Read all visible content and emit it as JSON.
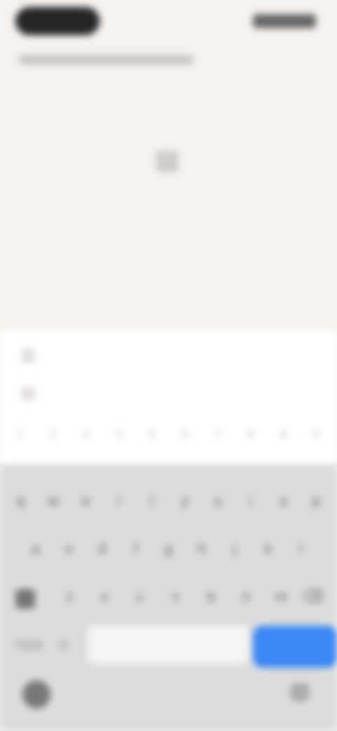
{
  "main": {
    "icon": "document-icon",
    "headline": "",
    "subline": ""
  },
  "suggestions": [
    {
      "text": ""
    },
    {
      "text": ""
    }
  ],
  "keyboard": {
    "number_row": [
      "1",
      "2",
      "3",
      "4",
      "5",
      "6",
      "7",
      "8",
      "9",
      "0"
    ],
    "row1": [
      "q",
      "w",
      "e",
      "r",
      "t",
      "y",
      "u",
      "i",
      "o",
      "p"
    ],
    "row2": [
      "a",
      "s",
      "d",
      "f",
      "g",
      "h",
      "j",
      "k",
      "l"
    ],
    "row3": [
      "z",
      "x",
      "c",
      "v",
      "b",
      "n",
      "m"
    ],
    "symbols_label": "?123",
    "action_label": ""
  },
  "colors": {
    "background": "#f5f2ef",
    "keyboard": "#dcdcde",
    "accent": "#3b87f5",
    "suggestion_text": "#d76a6a"
  }
}
